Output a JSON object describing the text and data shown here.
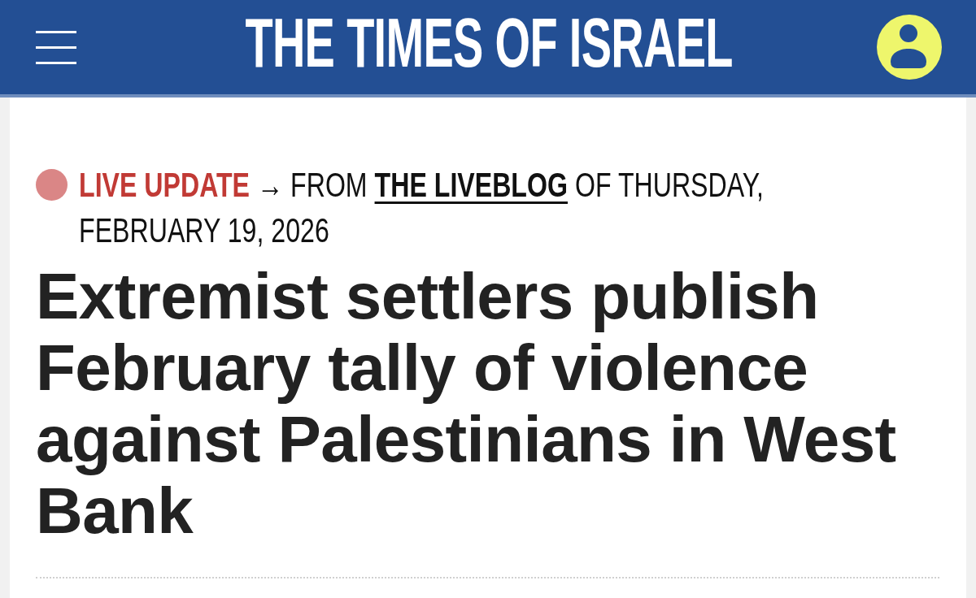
{
  "header": {
    "title": "THE TIMES OF ISRAEL"
  },
  "live_update": {
    "label": "LIVE UPDATE",
    "arrow": "→",
    "prefix": "FROM",
    "link": "THE LIVEBLOG",
    "suffix": "OF THURSDAY, FEBRUARY 19, 2026"
  },
  "headline": "Extremist settlers publish February tally of violence against Palestinians in West Bank"
}
